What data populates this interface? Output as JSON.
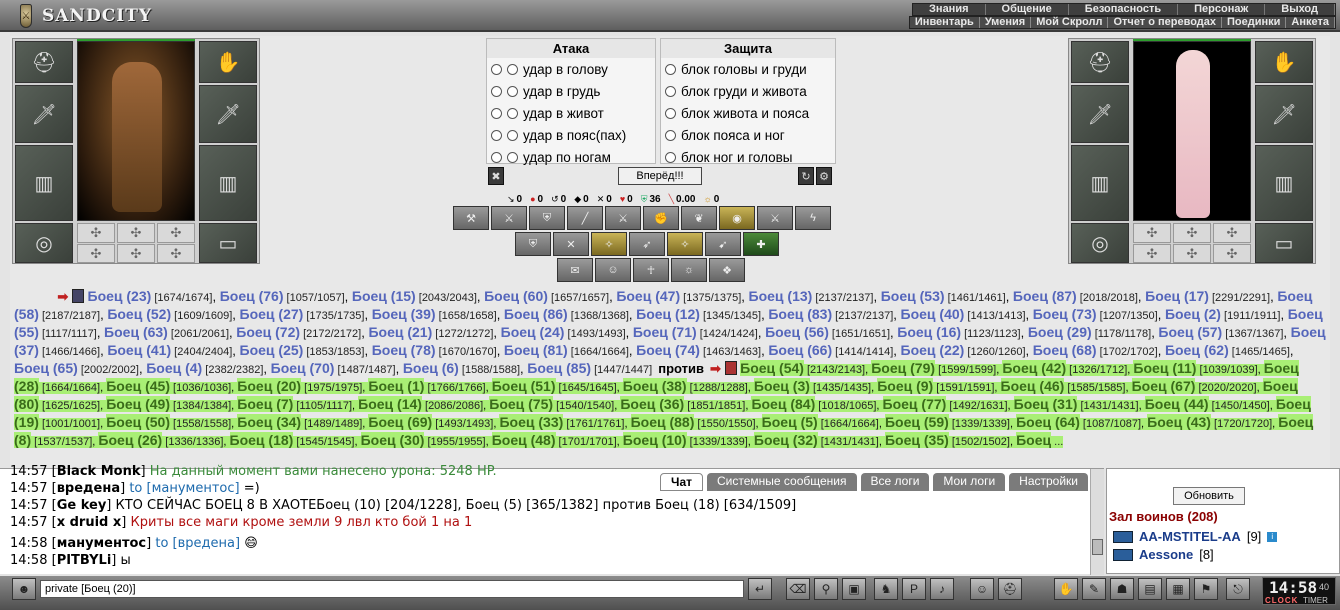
{
  "logo": {
    "text": "SANDCITY"
  },
  "menu_top": [
    "Знания",
    "Общение",
    "Безопасность",
    "Персонаж",
    "Выход"
  ],
  "menu_sub": [
    "Инвентарь",
    "Умения",
    "Мой Скролл",
    "Отчет о переводах",
    "Поединки",
    "Анкета"
  ],
  "combat": {
    "attack_title": "Атака",
    "defense_title": "Защита",
    "attacks": [
      "удар в голову",
      "удар в грудь",
      "удар в живот",
      "удар в пояс(пах)",
      "удар по ногам"
    ],
    "blocks": [
      "блок головы и груди",
      "блок груди и живота",
      "блок живота и пояса",
      "блок пояса и ног",
      "блок ног и головы"
    ],
    "go_button": "Вперёд!!!"
  },
  "stats": [
    {
      "icon": "sword-icon",
      "value": "0"
    },
    {
      "icon": "fire-icon",
      "value": "0"
    },
    {
      "icon": "counter-icon",
      "value": "0"
    },
    {
      "icon": "block-icon",
      "value": "0"
    },
    {
      "icon": "cross-swords-icon",
      "value": "0"
    },
    {
      "icon": "heart-icon",
      "value": "0"
    },
    {
      "icon": "shield-icon",
      "value": "36"
    },
    {
      "icon": "mana-icon",
      "value": "0.00"
    },
    {
      "icon": "spirit-icon",
      "value": "0"
    }
  ],
  "players": {
    "left_hp_fraction": 1.0,
    "right_hp_fraction": 1.0
  },
  "battle_log": {
    "team1": [
      [
        "Боец (23)",
        "[1674/1674]"
      ],
      [
        "Боец (76)",
        "[1057/1057]"
      ],
      [
        "Боец (15)",
        "[2043/2043]"
      ],
      [
        "Боец (60)",
        "[1657/1657]"
      ],
      [
        "Боец (47)",
        "[1375/1375]"
      ],
      [
        "Боец (13)",
        "[2137/2137]"
      ],
      [
        "Боец (53)",
        "[1461/1461]"
      ],
      [
        "Боец (87)",
        "[2018/2018]"
      ],
      [
        "Боец (17)",
        "[2291/2291]"
      ],
      [
        "Боец (58)",
        "[2187/2187]"
      ],
      [
        "Боец (52)",
        "[1609/1609]"
      ],
      [
        "Боец (27)",
        "[1735/1735]"
      ],
      [
        "Боец (39)",
        "[1658/1658]"
      ],
      [
        "Боец (86)",
        "[1368/1368]"
      ],
      [
        "Боец (12)",
        "[1345/1345]"
      ],
      [
        "Боец (83)",
        "[2137/2137]"
      ],
      [
        "Боец (40)",
        "[1413/1413]"
      ],
      [
        "Боец (73)",
        "[1207/1350]"
      ],
      [
        "Боец (2)",
        "[1911/1911]"
      ],
      [
        "Боец (55)",
        "[1117/1117]"
      ],
      [
        "Боец (63)",
        "[2061/2061]"
      ],
      [
        "Боец (72)",
        "[2172/2172]"
      ],
      [
        "Боец (21)",
        "[1272/1272]"
      ],
      [
        "Боец (24)",
        "[1493/1493]"
      ],
      [
        "Боец (71)",
        "[1424/1424]"
      ],
      [
        "Боец (56)",
        "[1651/1651]"
      ],
      [
        "Боец (16)",
        "[1123/1123]"
      ],
      [
        "Боец (29)",
        "[1178/1178]"
      ],
      [
        "Боец (57)",
        "[1367/1367]"
      ],
      [
        "Боец (37)",
        "[1466/1466]"
      ],
      [
        "Боец (41)",
        "[2404/2404]"
      ],
      [
        "Боец (25)",
        "[1853/1853]"
      ],
      [
        "Боец (78)",
        "[1670/1670]"
      ],
      [
        "Боец (81)",
        "[1664/1664]"
      ],
      [
        "Боец (74)",
        "[1463/1463]"
      ],
      [
        "Боец (66)",
        "[1414/1414]"
      ],
      [
        "Боец (22)",
        "[1260/1260]"
      ],
      [
        "Боец (68)",
        "[1702/1702]"
      ],
      [
        "Боец (62)",
        "[1465/1465]"
      ],
      [
        "Боец (65)",
        "[2002/2002]"
      ],
      [
        "Боец (4)",
        "[2382/2382]"
      ],
      [
        "Боец (70)",
        "[1487/1487]"
      ],
      [
        "Боец (6)",
        "[1588/1588]"
      ],
      [
        "Боец (85)",
        "[1447/1447]"
      ]
    ],
    "versus": "против",
    "team2": [
      [
        "Боец (54)",
        "[2143/2143]"
      ],
      [
        "Боец (79)",
        "[1599/1599]"
      ],
      [
        "Боец (42)",
        "[1326/1712]"
      ],
      [
        "Боец (11)",
        "[1039/1039]"
      ],
      [
        "Боец (28)",
        "[1664/1664]"
      ],
      [
        "Боец (45)",
        "[1036/1036]"
      ],
      [
        "Боец (20)",
        "[1975/1975]"
      ],
      [
        "Боец (1)",
        "[1766/1766]"
      ],
      [
        "Боец (51)",
        "[1645/1645]"
      ],
      [
        "Боец (38)",
        "[1288/1288]"
      ],
      [
        "Боец (3)",
        "[1435/1435]"
      ],
      [
        "Боец (9)",
        "[1591/1591]"
      ],
      [
        "Боец (46)",
        "[1585/1585]"
      ],
      [
        "Боец (67)",
        "[2020/2020]"
      ],
      [
        "Боец (80)",
        "[1625/1625]"
      ],
      [
        "Боец (49)",
        "[1384/1384]"
      ],
      [
        "Боец (7)",
        "[1105/1117]"
      ],
      [
        "Боец (14)",
        "[2086/2086]"
      ],
      [
        "Боец (75)",
        "[1540/1540]"
      ],
      [
        "Боец (36)",
        "[1851/1851]"
      ],
      [
        "Боец (84)",
        "[1018/1065]"
      ],
      [
        "Боец (77)",
        "[1492/1631]"
      ],
      [
        "Боец (31)",
        "[1431/1431]"
      ],
      [
        "Боец (44)",
        "[1450/1450]"
      ],
      [
        "Боец (19)",
        "[1001/1001]"
      ],
      [
        "Боец (50)",
        "[1558/1558]"
      ],
      [
        "Боец (34)",
        "[1489/1489]"
      ],
      [
        "Боец (69)",
        "[1493/1493]"
      ],
      [
        "Боец (33)",
        "[1761/1761]"
      ],
      [
        "Боец (88)",
        "[1550/1550]"
      ],
      [
        "Боец (5)",
        "[1664/1664]"
      ],
      [
        "Боец (59)",
        "[1339/1339]"
      ],
      [
        "Боец (64)",
        "[1087/1087]"
      ],
      [
        "Боец (43)",
        "[1720/1720]"
      ],
      [
        "Боец (8)",
        "[1537/1537]"
      ],
      [
        "Боец (26)",
        "[1336/1336]"
      ],
      [
        "Боец (18)",
        "[1545/1545]"
      ],
      [
        "Боец (30)",
        "[1955/1955]"
      ],
      [
        "Боец (48)",
        "[1701/1701]"
      ],
      [
        "Боец (10)",
        "[1339/1339]"
      ],
      [
        "Боец (32)",
        "[1431/1431]"
      ],
      [
        "Боец (35)",
        "[1502/1502]"
      ],
      [
        "Боец",
        "..."
      ]
    ]
  },
  "chat_tabs": [
    "Чат",
    "Системные сообщения",
    "Все логи",
    "Мои логи",
    "Настройки"
  ],
  "chat": [
    {
      "time": "14:57",
      "nick": "Black Monk",
      "to": "",
      "text": "На данный момент вами нанесено урона: 5248 HP."
    },
    {
      "time": "14:57",
      "nick": "вредена",
      "to": "to [манументос]",
      "text": "=)"
    },
    {
      "time": "14:57",
      "nick": "Ge key",
      "to": "",
      "text": "КТО СЕЙЧАС БОЕЦ 8 В ХАОТЕБоец (10) [204/1228], Боец (5) [365/1382] против Боец (18) [634/1509]"
    },
    {
      "time": "14:57",
      "nick": "x druid x",
      "to": "",
      "text": "Криты все маги кроме земли 9 лвл кто бой 1 на 1"
    },
    {
      "time": "14:58",
      "nick": "манументос",
      "to": "to [вредена]",
      "text": ""
    },
    {
      "time": "14:58",
      "nick": "PITBYLi",
      "to": "",
      "text": "ы"
    }
  ],
  "side": {
    "refresh": "Обновить",
    "room": "Зал воинов (208)",
    "users": [
      {
        "name": "AA-MSTITEL-AA",
        "level": "[9]"
      },
      {
        "name": "Aessone",
        "level": "[8]"
      }
    ]
  },
  "input": {
    "value": "private [Боец (20)]"
  },
  "clock": {
    "time": "14:58",
    "seconds": "40",
    "label1": "CLOCK",
    "label2": "TIMER"
  }
}
